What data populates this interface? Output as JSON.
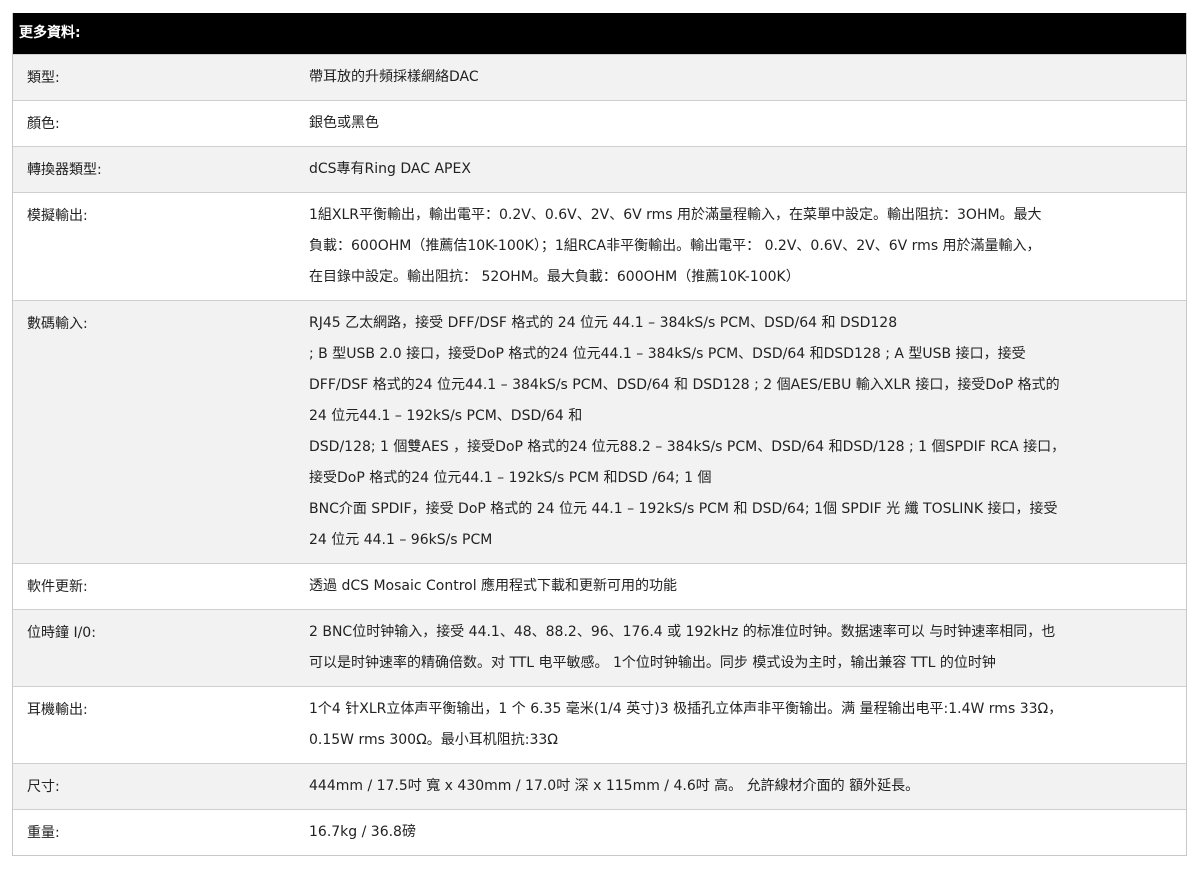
{
  "table": {
    "header": "更多資料:",
    "rows": [
      {
        "label": "類型:",
        "lines": [
          "帶耳放的升頻採樣網絡DAC"
        ]
      },
      {
        "label": "顏色:",
        "lines": [
          "銀色或黑色"
        ]
      },
      {
        "label": "轉換器類型:",
        "lines": [
          "dCS專有Ring DAC APEX"
        ]
      },
      {
        "label": "模擬輸出:",
        "lines": [
          "1組XLR平衡輸出，輸出電平：0.2V、0.6V、2V、6V rms 用於滿量程輸入，在菜單中設定。輸出阻抗：3OHM。最大",
          "負載：600OHM（推薦佶10K-100K）；1組RCA非平衡輸出。輸出電平： 0.2V、0.6V、2V、6V rms 用於滿量輸入，",
          "在目錄中設定。輸出阻抗： 52OHM。最大負載：600OHM（推薦10K-100K）"
        ]
      },
      {
        "label": "數碼輸入:",
        "lines": [
          "RJ45 乙太網路，接受 DFF/DSF 格式的 24 位元 44.1 – 384kS/s PCM、DSD/64 和 DSD128",
          "; B 型USB 2.0 接口，接受DoP 格式的24 位元44.1 – 384kS/s PCM、DSD/64 和DSD128 ; A 型USB 接口，接受",
          "DFF/DSF 格式的24 位元44.1 – 384kS/s PCM、DSD/64 和 DSD128 ; 2 個AES/EBU 輸入XLR 接口，接受DoP 格式的",
          "24 位元44.1 – 192kS/s PCM、DSD/64 和",
          "DSD/128; 1 個雙AES ，接受DoP 格式的24 位元88.2 – 384kS/s PCM、DSD/64 和DSD/128 ; 1 個SPDIF RCA 接口，",
          "接受DoP 格式的24 位元44.1 – 192kS/s PCM 和DSD /64; 1 個",
          "BNC介面 SPDIF，接受 DoP 格式的 24 位元 44.1 – 192kS/s PCM 和 DSD/64; 1個 SPDIF 光 纖 TOSLINK 接口，接受",
          "24 位元 44.1 – 96kS/s PCM"
        ]
      },
      {
        "label": "軟件更新:",
        "lines": [
          "透過 dCS Mosaic Control 應用程式下載和更新可用的功能"
        ]
      },
      {
        "label": "位時鐘 I/0:",
        "lines": [
          "2 BNC位时钟输入，接受 44.1、48、88.2、96、176.4 或 192kHz 的标准位时钟。数据速率可以 与时钟速率相同，也",
          "可以是时钟速率的精确倍数。对 TTL 电平敏感。 1个位时钟输出。同步 模式设为主时，输出兼容 TTL 的位时钟"
        ]
      },
      {
        "label": "耳機輸出:",
        "lines": [
          "1个4 针XLR立体声平衡输出，1 个 6.35 毫米(1/4 英寸)3 极插孔立体声非平衡输出。满 量程输出电平:1.4W rms 33Ω，",
          "0.15W rms 300Ω。最小耳机阻抗:33Ω"
        ]
      },
      {
        "label": "尺寸:",
        "lines": [
          "444mm / 17.5吋 寬 x 430mm / 17.0吋 深 x 115mm / 4.6吋 高。 允許線材介面的 額外延長。"
        ]
      },
      {
        "label": "重量:",
        "lines": [
          "16.7kg / 36.8磅"
        ]
      }
    ]
  }
}
